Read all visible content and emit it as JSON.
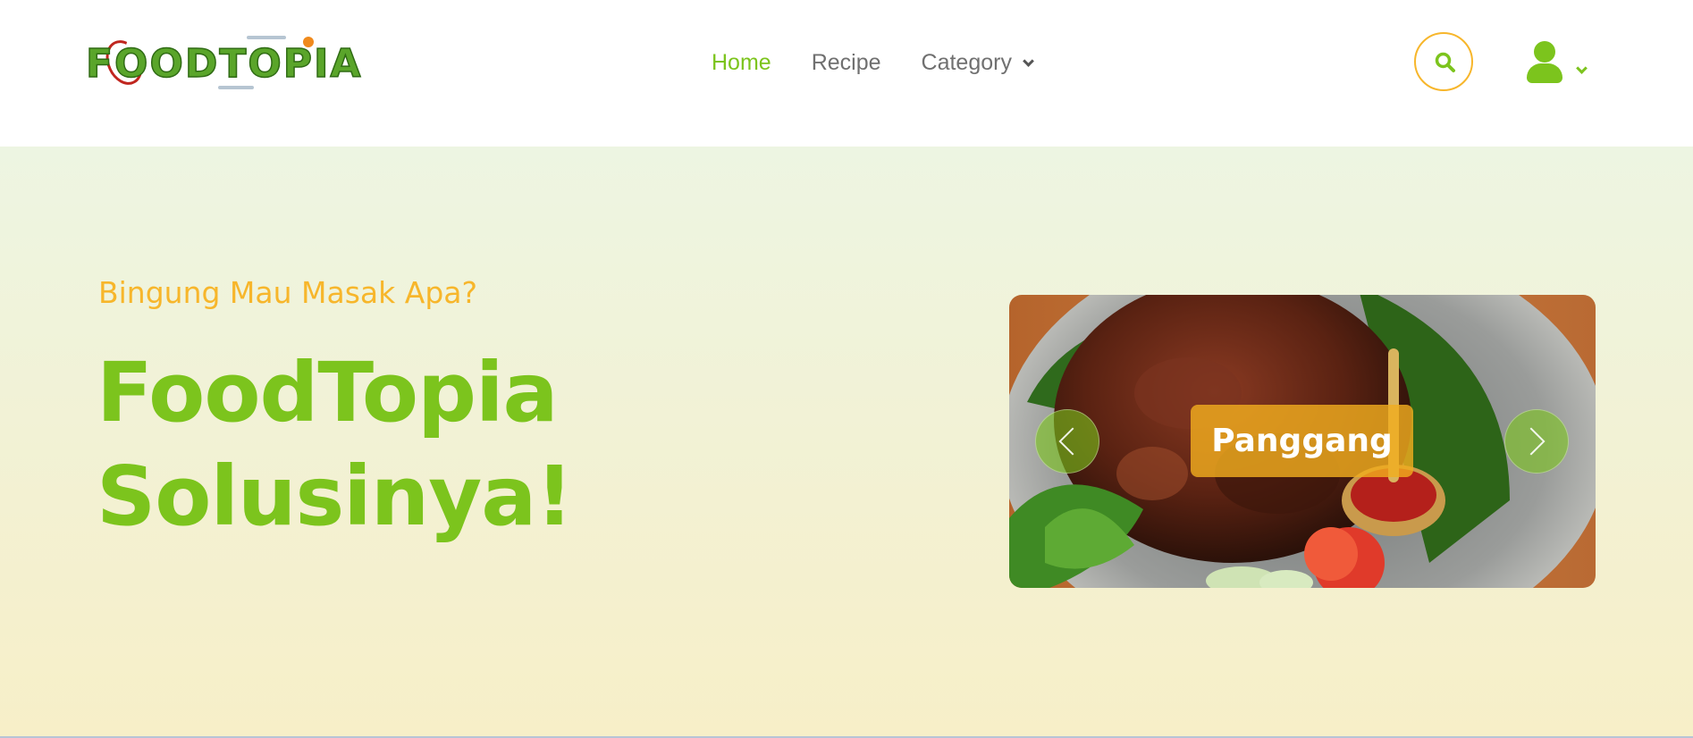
{
  "brand": {
    "logo_text": "FOODTOPIA"
  },
  "nav": {
    "items": [
      {
        "label": "Home",
        "active": true
      },
      {
        "label": "Recipe",
        "active": false
      },
      {
        "label": "Category",
        "active": false,
        "has_dropdown": true
      }
    ]
  },
  "header_actions": {
    "search_icon": "search-icon",
    "user_icon": "user-icon"
  },
  "hero": {
    "tagline": "Bingung Mau Masak Apa?",
    "headline_line1": "FoodTopia",
    "headline_line2": "Solusinya!"
  },
  "carousel": {
    "caption": "Panggang",
    "prev_icon": "chevron-left-icon",
    "next_icon": "chevron-right-icon"
  },
  "colors": {
    "accent_green": "#7cc41d",
    "accent_orange": "#f7b62b",
    "nav_text": "#707070"
  }
}
